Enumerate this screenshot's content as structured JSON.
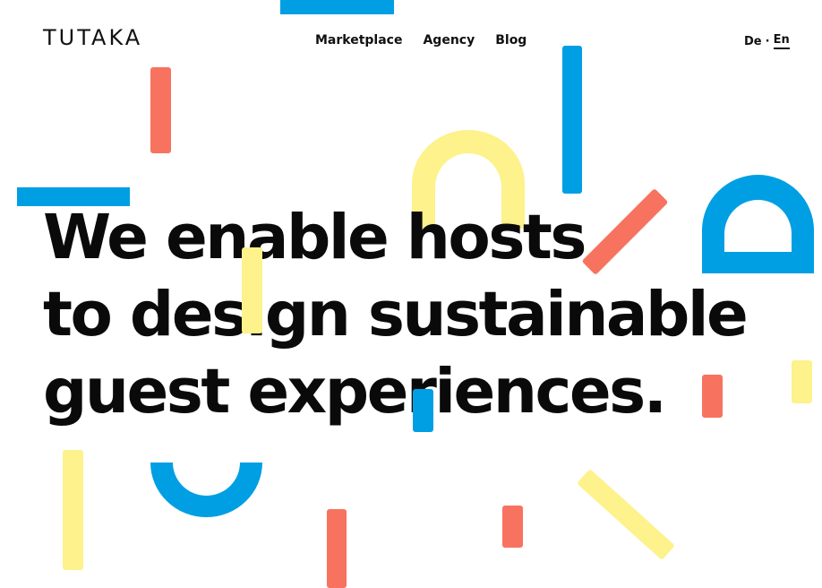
{
  "brand": {
    "logo_text": "TUTAKA"
  },
  "nav": {
    "items": [
      "Marketplace",
      "Agency",
      "Blog"
    ]
  },
  "language": {
    "de": "De",
    "separator": "·",
    "en": "En",
    "active": "En"
  },
  "hero": {
    "lines": [
      "We enable hosts",
      "to design sustainable",
      "guest experiences."
    ]
  },
  "colors": {
    "blue": "#009fe3",
    "yellow": "#fdf28b",
    "coral": "#f7735f",
    "text": "#0a0a0a"
  }
}
